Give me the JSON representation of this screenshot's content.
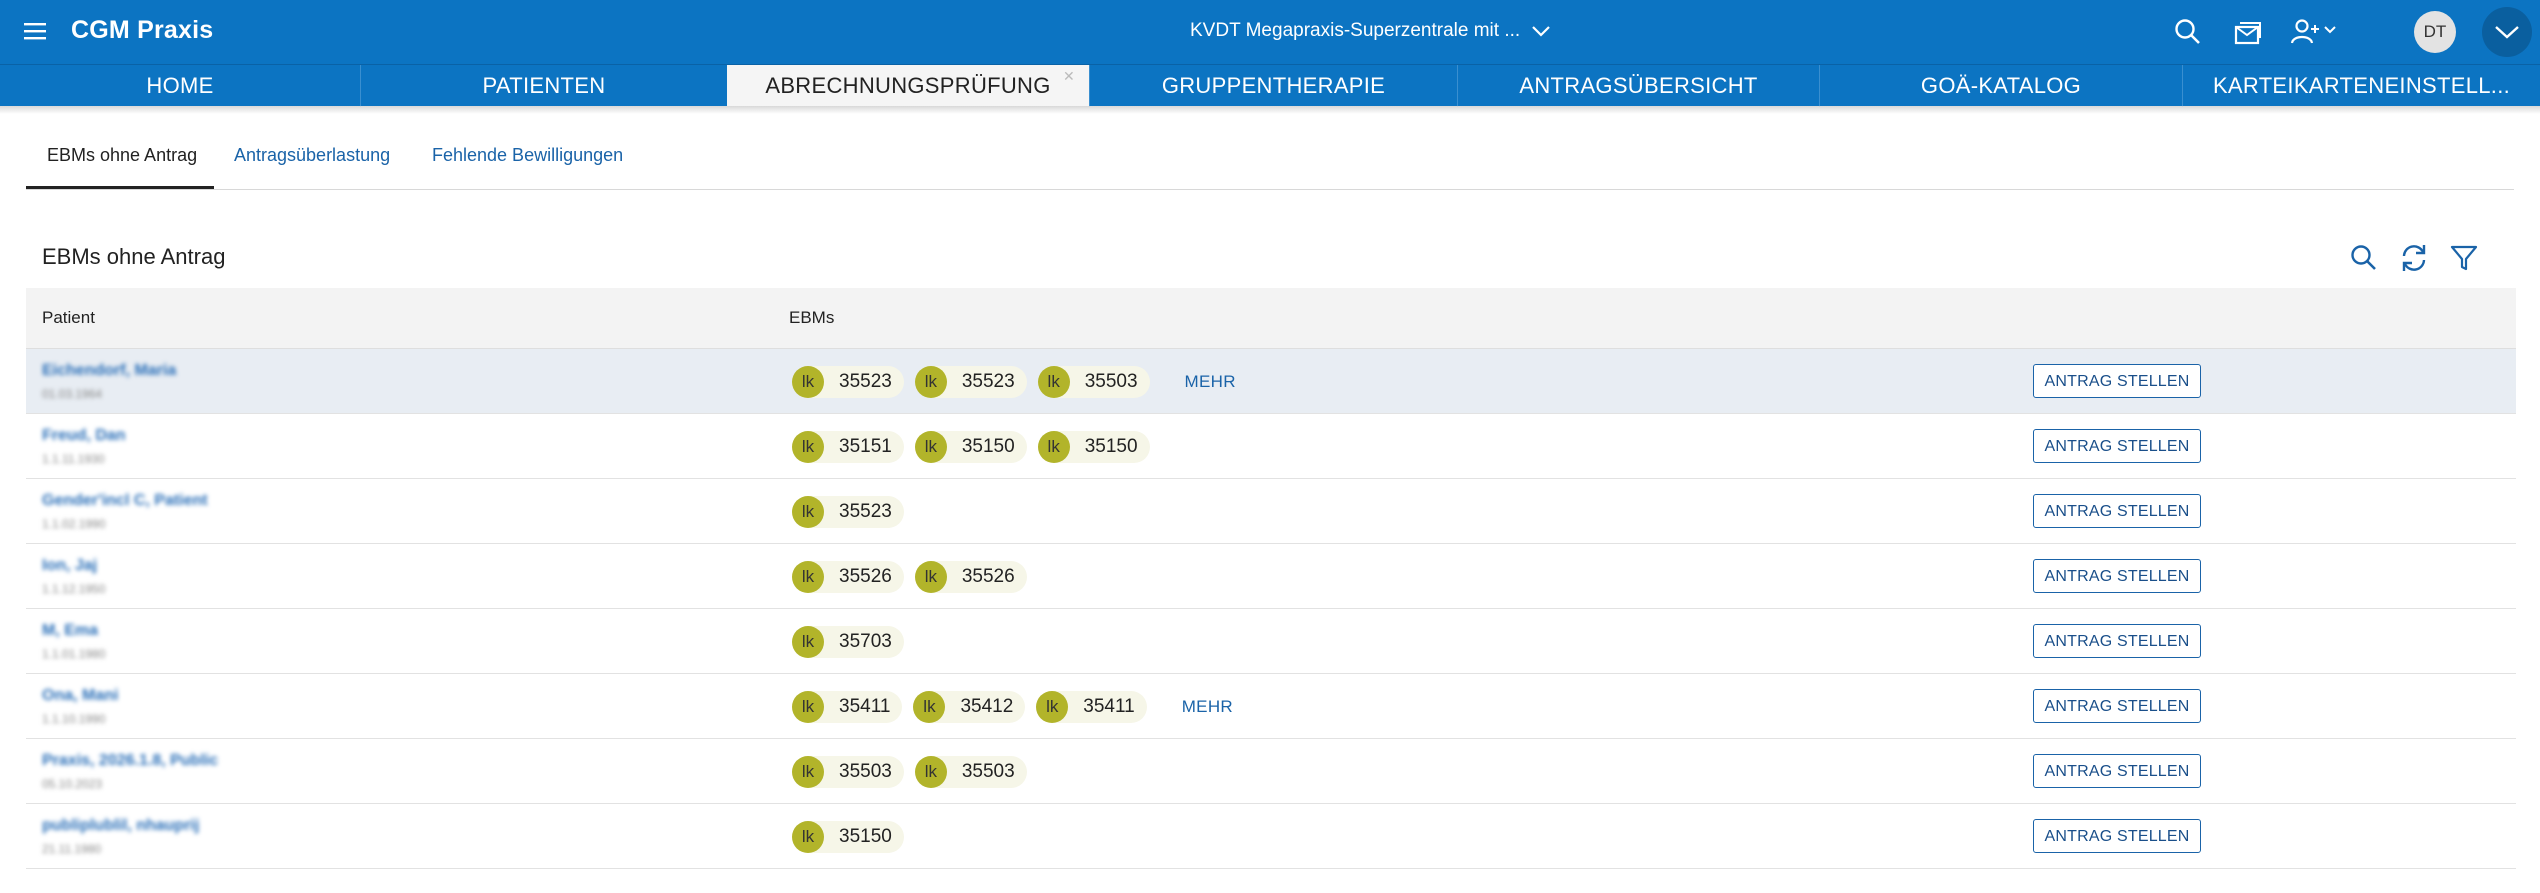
{
  "app": {
    "title": "CGM Praxis",
    "site": "KVDT Megapraxis-Superzentrale mit ...",
    "user_initials": "DT"
  },
  "nav_tabs": [
    {
      "label": "HOME"
    },
    {
      "label": "PATIENTEN"
    },
    {
      "label": "ABRECHNUNGSPRÜFUNG",
      "active": true
    },
    {
      "label": "GRUPPENTHERAPIE"
    },
    {
      "label": "ANTRAGSÜBERSICHT"
    },
    {
      "label": "GOÄ-KATALOG"
    },
    {
      "label": "KARTEIKARTENEINSTELL..."
    }
  ],
  "subtabs": [
    {
      "label": "EBMs ohne Antrag",
      "active": true
    },
    {
      "label": "Antragsüberlastung"
    },
    {
      "label": "Fehlende Bewilligungen"
    }
  ],
  "section": {
    "title": "EBMs ohne Antrag"
  },
  "table": {
    "columns": [
      "Patient",
      "EBMs"
    ],
    "badge_label": "lk",
    "more_label": "MEHR",
    "action_label": "ANTRAG STELLEN",
    "rows": [
      {
        "name": "Eichendorf, Maria",
        "dob": "01.03.1964",
        "ebms": [
          "35523",
          "35523",
          "35503"
        ],
        "more": true
      },
      {
        "name": "Freud, Dan",
        "dob": "1.1.11.1930",
        "ebms": [
          "35151",
          "35150",
          "35150"
        ],
        "more": false
      },
      {
        "name": "Gender'incl C, Patient",
        "dob": "1.1.02.1990",
        "ebms": [
          "35523"
        ],
        "more": false
      },
      {
        "name": "Ion, Jaj",
        "dob": "1.1.12.1950",
        "ebms": [
          "35526",
          "35526"
        ],
        "more": false
      },
      {
        "name": "M, Ema",
        "dob": "1.1.01.1980",
        "ebms": [
          "35703"
        ],
        "more": false
      },
      {
        "name": "Ona, Mani",
        "dob": "1.1.10.1990",
        "ebms": [
          "35411",
          "35412",
          "35411"
        ],
        "more": true
      },
      {
        "name": "Praxis, 2026.1.8, Public",
        "dob": "05.10.2023",
        "ebms": [
          "35503",
          "35503"
        ],
        "more": false
      },
      {
        "name": "publiplublil, nhauprij",
        "dob": "21.11.1980",
        "ebms": [
          "35150"
        ],
        "more": false
      }
    ]
  },
  "colors": {
    "brand": "#0c74c2",
    "badge": "#b2b42a",
    "link": "#1a63a8"
  }
}
